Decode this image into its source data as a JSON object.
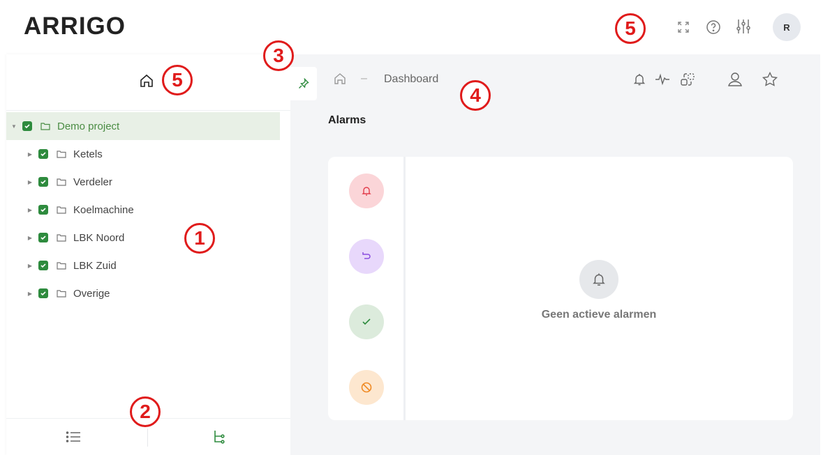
{
  "app": {
    "logo_text": "ARRIGO"
  },
  "topbar": {
    "icons": [
      "fullscreen-icon",
      "help-icon",
      "settings-sliders-icon"
    ],
    "avatar_initial": "R"
  },
  "sidebar": {
    "header_icon": "home-icon",
    "tree": [
      {
        "label": "Demo project",
        "expanded": true,
        "checked": true,
        "selected": true
      },
      {
        "label": "Ketels",
        "checked": true
      },
      {
        "label": "Verdeler",
        "checked": true
      },
      {
        "label": "Koelmachine",
        "checked": true
      },
      {
        "label": "LBK Noord",
        "checked": true
      },
      {
        "label": "LBK Zuid",
        "checked": true
      },
      {
        "label": "Overige",
        "checked": true
      }
    ],
    "footer_tabs": [
      "list-view-icon",
      "tree-view-icon"
    ]
  },
  "main": {
    "breadcrumb": {
      "separator": "–",
      "current": "Dashboard"
    },
    "actions": [
      "bell-icon",
      "pulse-icon",
      "layers-icon",
      "user-icon",
      "star-icon"
    ],
    "section_title": "Alarms",
    "alarm_states": [
      "alarm-active-icon",
      "alarm-returned-icon",
      "alarm-acknowledged-icon",
      "alarm-blocked-icon"
    ],
    "empty_text": "Geen actieve alarmen"
  },
  "callouts": [
    "1",
    "2",
    "3",
    "4",
    "5",
    "5"
  ],
  "colors": {
    "accent_green": "#2e8b3e",
    "callout_red": "#e01b1b"
  }
}
